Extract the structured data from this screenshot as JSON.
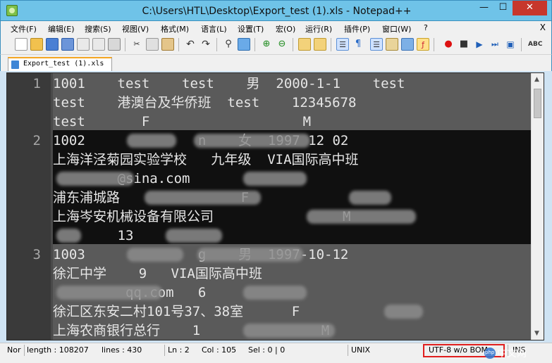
{
  "window": {
    "title": "C:\\Users\\HTL\\Desktop\\Export_test (1).xls - Notepad++",
    "minimize": "—",
    "maximize": "☐",
    "close": "✕"
  },
  "menu": {
    "items": [
      "文件(F)",
      "编辑(E)",
      "搜索(S)",
      "视图(V)",
      "格式(M)",
      "语言(L)",
      "设置(T)",
      "宏(O)",
      "运行(R)",
      "插件(P)",
      "窗口(W)",
      "?"
    ],
    "close_x": "X"
  },
  "tab": {
    "label": "Export_test (1).xls"
  },
  "editor": {
    "line_numbers": [
      "1",
      "2",
      "3"
    ],
    "lines": [
      "1001    test    test    男  2000-1-1    test",
      "test    港澳台及华侨班  test    12345678",
      "test       F                   M",
      "1002              n    女  1997 12 02",
      "上海洋泾菊园实验学校   九年级  VIA国际高中班",
      "        @sina.com",
      "浦东浦城路               F",
      "上海岑安机械设备有限公司                M",
      "        13",
      "1003              g    男  1997-10-12",
      "徐汇中学    9   VIA国际高中班",
      "         qq.com   6",
      "徐汇区东安二村101号37、38室      F",
      "上海农商银行总行    1               M"
    ]
  },
  "status": {
    "mode": "Nor",
    "length": "length : 108207",
    "lines": "lines : 430",
    "ln": "Ln : 2",
    "col": "Col : 105",
    "sel": "Sel : 0 | 0",
    "eol": "UNIX",
    "encoding": "UTF-8 w/o BOM",
    "ins": "INS"
  },
  "watermark": "中文网",
  "colors": {
    "titlebar": "#6fc3e8",
    "editor_bg": "#3f3f3f",
    "highlight_red": "#e01e1e"
  }
}
